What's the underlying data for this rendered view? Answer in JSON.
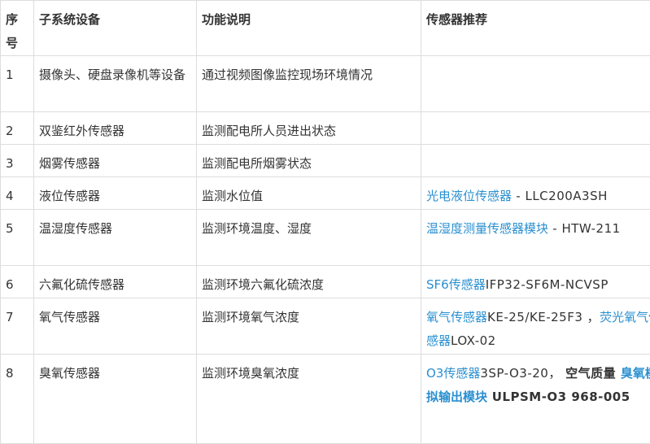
{
  "table": {
    "headers": [
      "序号",
      "子系统设备",
      "功能说明",
      "传感器推荐"
    ],
    "rows": [
      {
        "no": "1",
        "device": "摄像头、硬盘录像机等设备",
        "function": "通过视频图像监控现场环境情况",
        "rec": []
      },
      {
        "no": "2",
        "device": "双鉴红外传感器",
        "function": "监测配电所人员进出状态",
        "rec": []
      },
      {
        "no": "3",
        "device": "烟雾传感器",
        "function": "监测配电所烟雾状态",
        "rec": []
      },
      {
        "no": "4",
        "device": "液位传感器",
        "function": "监测水位值",
        "rec": [
          {
            "text": "光电液位传感器",
            "link": true
          },
          {
            "text": " - LLC200A3SH",
            "link": false
          }
        ]
      },
      {
        "no": "5",
        "device": "温湿度传感器",
        "function": "监测环境温度、湿度",
        "rec": [
          {
            "text": "温湿度测量传感器模块",
            "link": true
          },
          {
            "text": " - HTW-211",
            "link": false
          }
        ]
      },
      {
        "no": "6",
        "device": "六氟化硫传感器",
        "function": "监测环境六氟化硫浓度",
        "rec": [
          {
            "text": "SF6传感器",
            "link": true
          },
          {
            "text": "IFP32-SF6M-NCVSP",
            "link": false
          }
        ]
      },
      {
        "no": "7",
        "device": "氧气传感器",
        "function": "监测环境氧气浓度",
        "rec": [
          {
            "text": "氧气传感器",
            "link": true
          },
          {
            "text": "KE-25/KE-25F3 ，",
            "link": false
          },
          {
            "text": "荧光氧气传感器",
            "link": true
          },
          {
            "text": "LOX-02",
            "link": false
          }
        ]
      },
      {
        "no": "8",
        "device": "臭氧传感器",
        "function": "监测环境臭氧浓度",
        "rec": [
          {
            "text": "O3传感器",
            "link": true
          },
          {
            "text": "3SP-O3-20， ",
            "link": false
          },
          {
            "text": "空气质量 ",
            "link": false,
            "bold": true
          },
          {
            "text": "臭氧模拟输出模块",
            "link": true,
            "bold": true
          },
          {
            "text": " ULPSM-O3 968-005",
            "link": false,
            "bold": true
          }
        ]
      }
    ]
  },
  "colors": {
    "link": "#2a8fd0",
    "text": "#333333",
    "border": "#dddddd"
  }
}
